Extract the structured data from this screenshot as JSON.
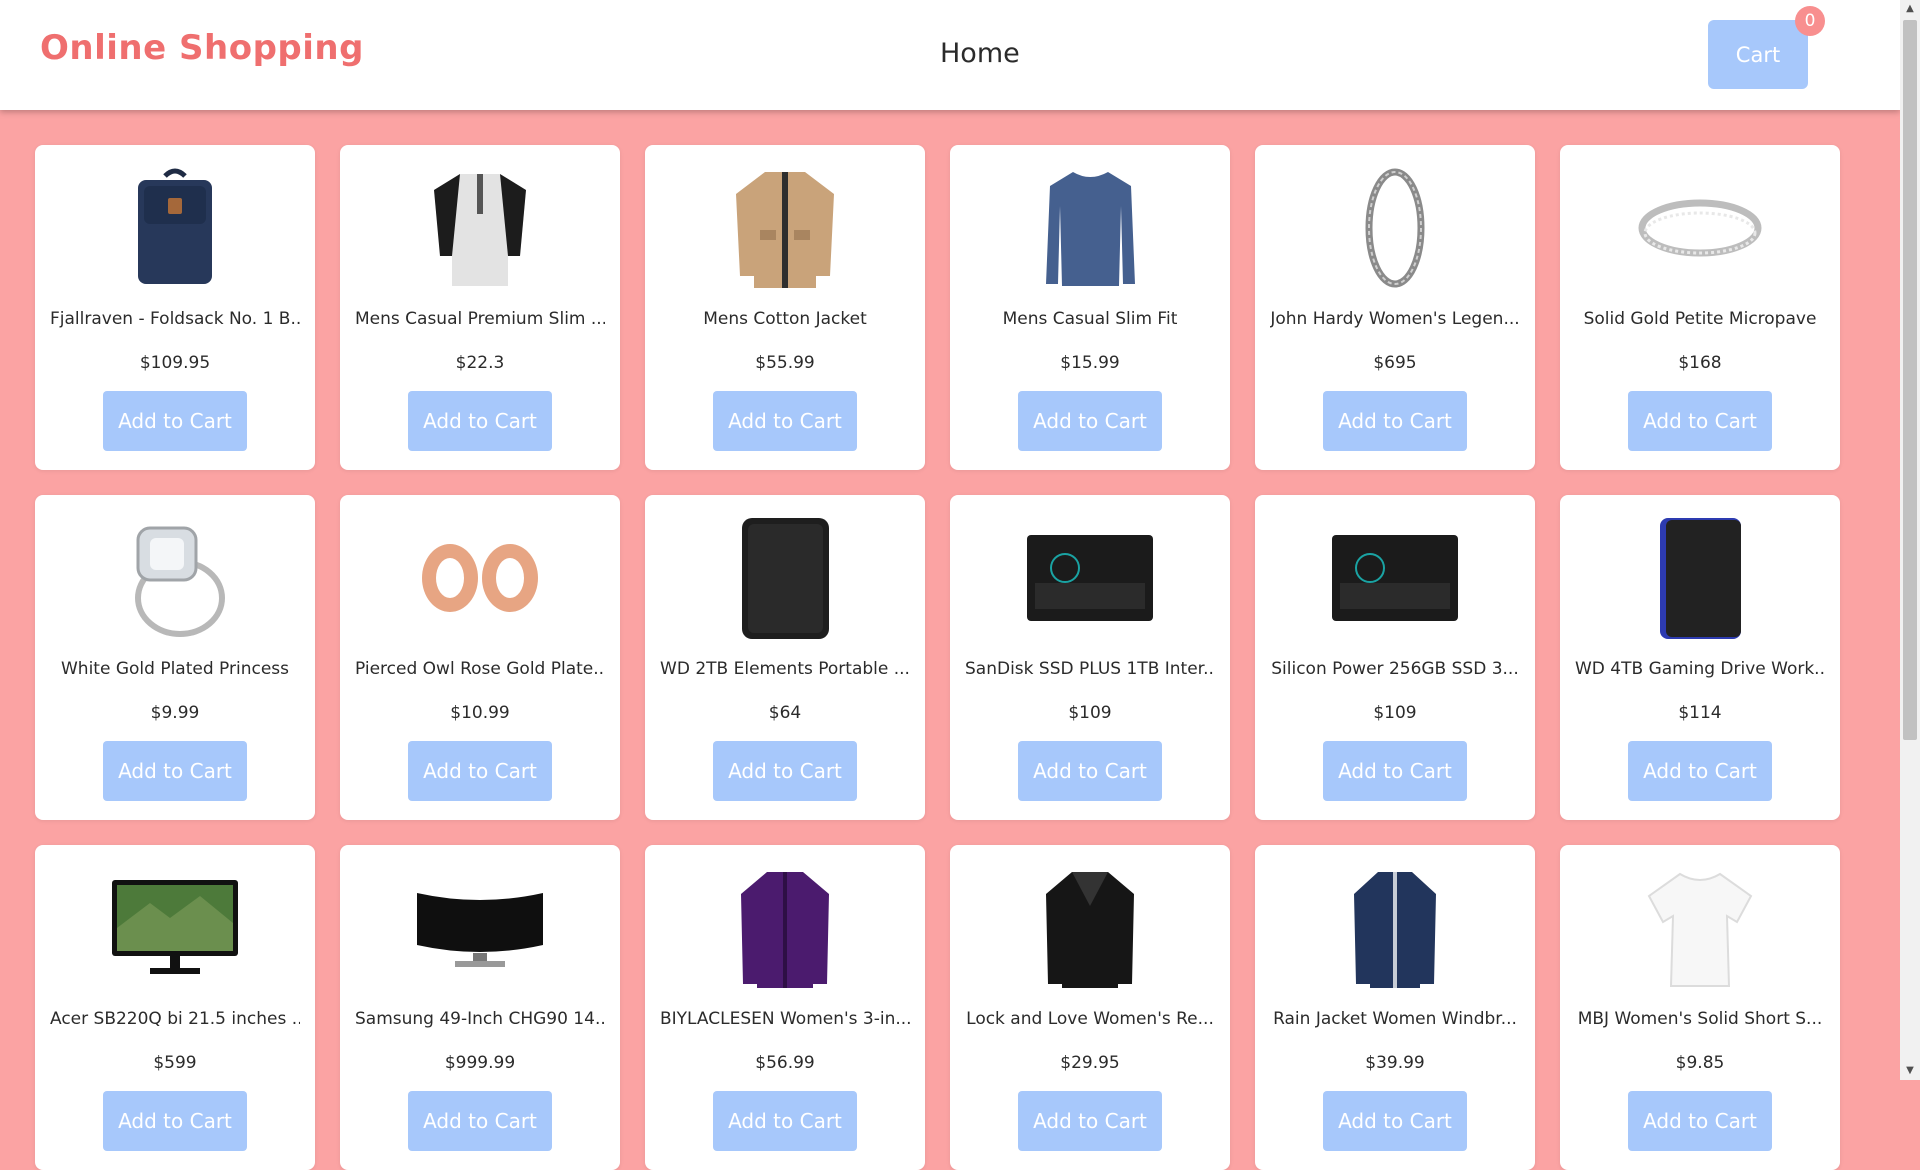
{
  "header": {
    "brand": "Online Shopping",
    "nav_home": "Home",
    "cart_label": "Cart",
    "cart_count": "0"
  },
  "colors": {
    "page_background": "#fba3a3",
    "brand": "#ef6f6f",
    "button": "#a7c8fb",
    "badge": "#f88f8f"
  },
  "products": [
    {
      "title": "Fjallraven - Foldsack No. 1 B...",
      "price": "$109.95",
      "button": "Add to Cart",
      "icon": "backpack-icon"
    },
    {
      "title": "Mens Casual Premium Slim ...",
      "price": "$22.3",
      "button": "Add to Cart",
      "icon": "tshirt-icon"
    },
    {
      "title": "Mens Cotton Jacket",
      "price": "$55.99",
      "button": "Add to Cart",
      "icon": "jacket-icon"
    },
    {
      "title": "Mens Casual Slim Fit",
      "price": "$15.99",
      "button": "Add to Cart",
      "icon": "longsleeve-icon"
    },
    {
      "title": "John Hardy Women's Legen...",
      "price": "$695",
      "button": "Add to Cart",
      "icon": "bracelet-icon"
    },
    {
      "title": "Solid Gold Petite Micropave",
      "price": "$168",
      "button": "Add to Cart",
      "icon": "ring-icon"
    },
    {
      "title": "White Gold Plated Princess",
      "price": "$9.99",
      "button": "Add to Cart",
      "icon": "diamond-ring-icon"
    },
    {
      "title": "Pierced Owl Rose Gold Plate...",
      "price": "$10.99",
      "button": "Add to Cart",
      "icon": "earrings-icon"
    },
    {
      "title": "WD 2TB Elements Portable ...",
      "price": "$64",
      "button": "Add to Cart",
      "icon": "hard-drive-icon"
    },
    {
      "title": "SanDisk SSD PLUS 1TB Inter...",
      "price": "$109",
      "button": "Add to Cart",
      "icon": "ssd-icon"
    },
    {
      "title": "Silicon Power 256GB SSD 3...",
      "price": "$109",
      "button": "Add to Cart",
      "icon": "ssd-icon"
    },
    {
      "title": "WD 4TB Gaming Drive Work...",
      "price": "$114",
      "button": "Add to Cart",
      "icon": "gaming-drive-icon"
    },
    {
      "title": "Acer SB220Q bi 21.5 inches ...",
      "price": "$599",
      "button": "Add to Cart",
      "icon": "monitor-icon"
    },
    {
      "title": "Samsung 49-Inch CHG90 14...",
      "price": "$999.99",
      "button": "Add to Cart",
      "icon": "curved-monitor-icon"
    },
    {
      "title": "BIYLACLESEN Women's 3-in...",
      "price": "$56.99",
      "button": "Add to Cart",
      "icon": "snow-jacket-icon"
    },
    {
      "title": "Lock and Love Women's Re...",
      "price": "$29.95",
      "button": "Add to Cart",
      "icon": "leather-jacket-icon"
    },
    {
      "title": "Rain Jacket Women Windbr...",
      "price": "$39.99",
      "button": "Add to Cart",
      "icon": "rain-jacket-icon"
    },
    {
      "title": "MBJ Women's Solid Short S...",
      "price": "$9.85",
      "button": "Add to Cart",
      "icon": "womens-tee-icon"
    }
  ]
}
